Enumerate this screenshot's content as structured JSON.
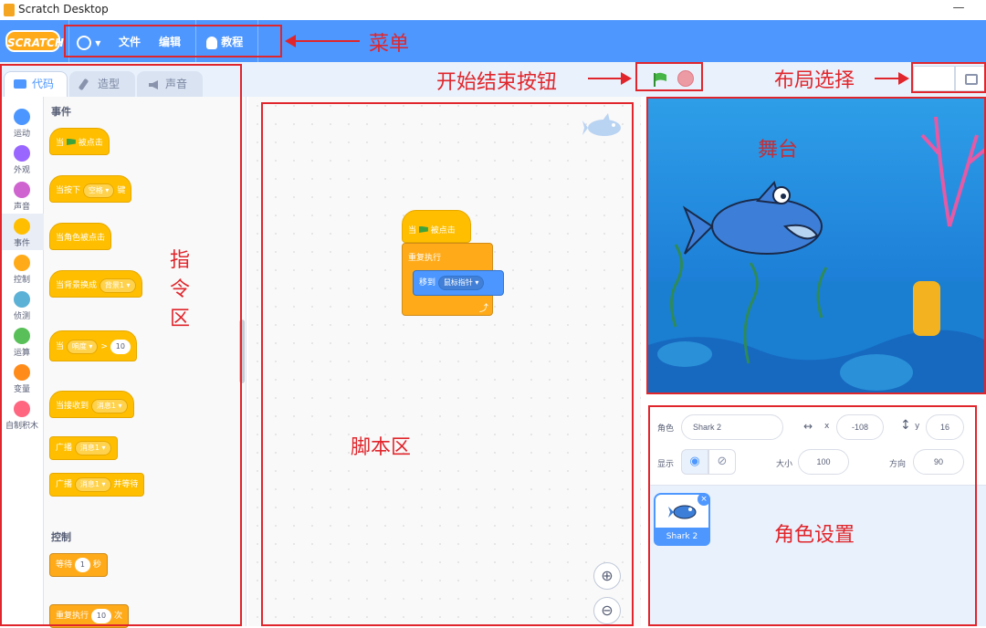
{
  "window": {
    "title": "Scratch Desktop"
  },
  "menu": {
    "logo": "SCRATCH",
    "file": "文件",
    "edit": "编辑",
    "tutorials": "教程"
  },
  "tabs": {
    "code": "代码",
    "costumes": "造型",
    "sounds": "声音"
  },
  "categories": [
    "运动",
    "外观",
    "声音",
    "事件",
    "控制",
    "侦测",
    "运算",
    "变量",
    "自制积木"
  ],
  "palette": {
    "events_title": "事件",
    "when_flag_clicked_pre": "当",
    "when_flag_clicked_post": "被点击",
    "when_key_pressed_pre": "当按下",
    "when_key_pressed_key": "空格",
    "when_key_pressed_post": "键",
    "when_sprite_clicked": "当角色被点击",
    "when_backdrop_switches": "当背景换成",
    "backdrop_option": "背景1",
    "when_greater_pre": "当",
    "when_greater_option": "响度",
    "when_greater_op": ">",
    "when_greater_value": "10",
    "when_receive": "当接收到",
    "message_option": "消息1",
    "broadcast": "广播",
    "broadcast_and_wait_post": "并等待",
    "control_title": "控制",
    "wait_label": "等待",
    "wait_value": "1",
    "wait_unit": "秒",
    "repeat_label": "重复执行",
    "repeat_value": "10",
    "repeat_unit": "次"
  },
  "script": {
    "hat_pre": "当",
    "hat_post": "被点击",
    "forever": "重复执行",
    "goto": "移到",
    "goto_target": "鼠标指针"
  },
  "sprite_info": {
    "sprite_label": "角色",
    "sprite_name": "Shark 2",
    "x_label": "x",
    "x_value": "-108",
    "y_label": "y",
    "y_value": "16",
    "show_label": "显示",
    "size_label": "大小",
    "size_value": "100",
    "direction_label": "方向",
    "direction_value": "90"
  },
  "sprite_list": [
    {
      "name": "Shark 2"
    }
  ],
  "annotations": {
    "menu": "菜单",
    "start_stop": "开始结束按钮",
    "layout": "布局选择",
    "stage": "舞台",
    "blocks": "指令区",
    "script_area": "脚本区",
    "sprite_settings": "角色设置"
  },
  "colors": {
    "menu_bar": "#4d97ff",
    "events": "#ffbf00",
    "control": "#ffab19",
    "motion": "#4c97ff",
    "annotation": "#e0262c"
  }
}
